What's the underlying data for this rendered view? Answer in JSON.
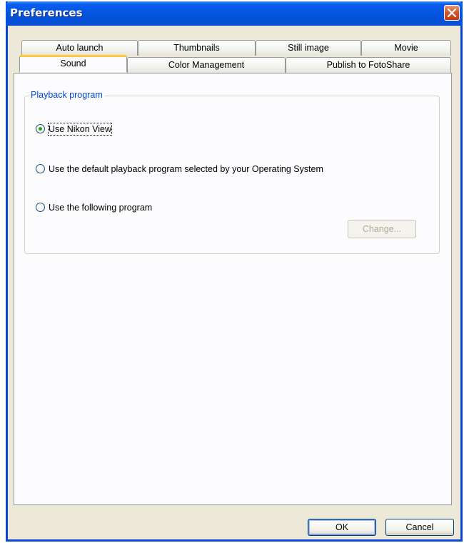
{
  "window": {
    "title": "Preferences"
  },
  "tabs": {
    "row_back": [
      {
        "label": "Auto launch"
      },
      {
        "label": "Thumbnails"
      },
      {
        "label": "Still image"
      },
      {
        "label": "Movie"
      }
    ],
    "row_front": [
      {
        "label": "Sound",
        "active": true
      },
      {
        "label": "Color Management"
      },
      {
        "label": "Publish to FotoShare"
      }
    ]
  },
  "playback_group": {
    "title": "Playback program",
    "options": [
      {
        "label": "Use Nikon View",
        "selected": true,
        "mnemonic": "V"
      },
      {
        "label": "Use the default playback program selected by your Operating System",
        "selected": false,
        "mnemonic": "O"
      },
      {
        "label": "Use the following program",
        "selected": false,
        "mnemonic": "m"
      }
    ],
    "change_label": "Change...",
    "change_enabled": false
  },
  "buttons": {
    "ok_label": "OK",
    "cancel_label": "Cancel"
  },
  "icons": {
    "close": "close-icon",
    "radio_checked_color": "#21a121"
  }
}
